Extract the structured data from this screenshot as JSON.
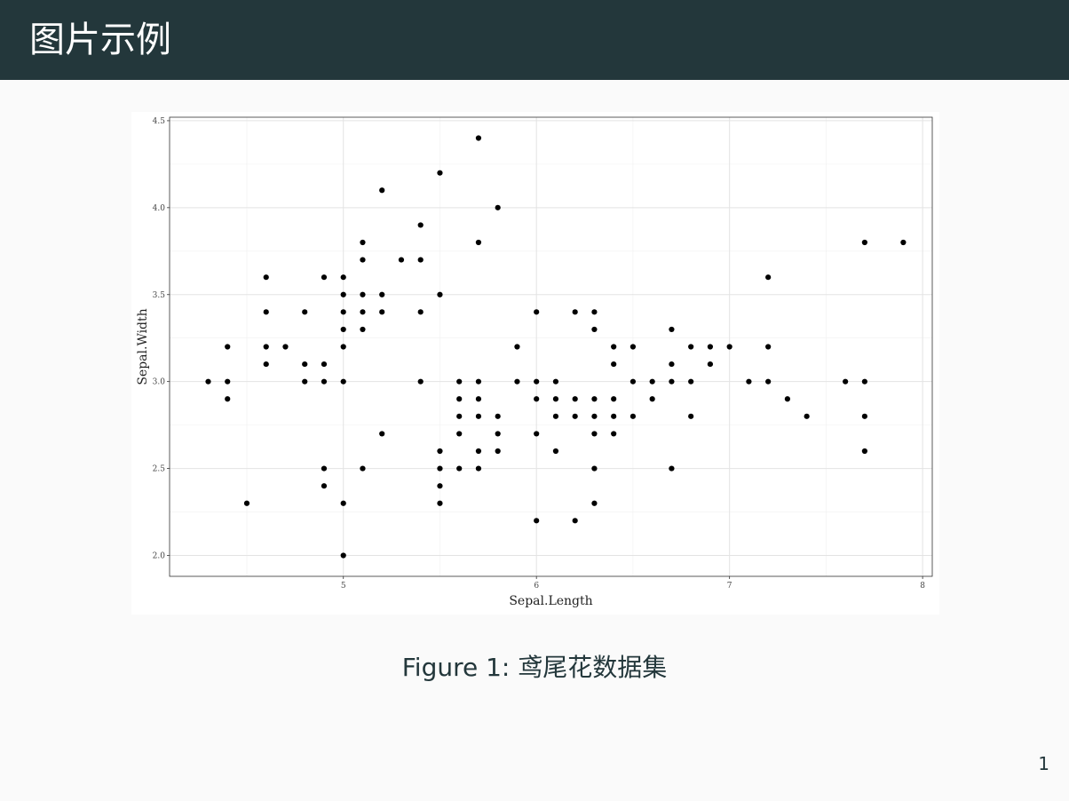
{
  "header": {
    "title": "图片示例"
  },
  "caption": {
    "label": "Figure 1:",
    "text": "鸢尾花数据集"
  },
  "page_number": "1",
  "chart_data": {
    "type": "scatter",
    "xlabel": "Sepal.Length",
    "ylabel": "Sepal.Width",
    "xlim": [
      4.1,
      8.05
    ],
    "ylim": [
      1.88,
      4.52
    ],
    "x_ticks": [
      5,
      6,
      7,
      8
    ],
    "x_tick_labels": [
      "5",
      "6",
      "7",
      "8"
    ],
    "y_ticks": [
      2.0,
      2.5,
      3.0,
      3.5,
      4.0,
      4.5
    ],
    "y_tick_labels": [
      "2.0",
      "2.5",
      "3.0",
      "3.5",
      "4.0",
      "4.5"
    ],
    "grid": true,
    "point_color": "#000000",
    "points": [
      [
        4.3,
        3.0
      ],
      [
        4.4,
        3.2
      ],
      [
        4.4,
        3.0
      ],
      [
        4.4,
        2.9
      ],
      [
        4.5,
        2.3
      ],
      [
        4.6,
        3.6
      ],
      [
        4.6,
        3.4
      ],
      [
        4.6,
        3.2
      ],
      [
        4.6,
        3.1
      ],
      [
        4.7,
        3.2
      ],
      [
        4.8,
        3.4
      ],
      [
        4.8,
        3.1
      ],
      [
        4.8,
        3.0
      ],
      [
        4.9,
        3.6
      ],
      [
        4.9,
        3.1
      ],
      [
        4.9,
        3.0
      ],
      [
        4.9,
        2.5
      ],
      [
        4.9,
        2.4
      ],
      [
        5.0,
        3.6
      ],
      [
        5.0,
        3.5
      ],
      [
        5.0,
        3.4
      ],
      [
        5.0,
        3.3
      ],
      [
        5.0,
        3.2
      ],
      [
        5.0,
        3.0
      ],
      [
        5.0,
        2.3
      ],
      [
        5.0,
        2.0
      ],
      [
        5.1,
        3.8
      ],
      [
        5.1,
        3.7
      ],
      [
        5.1,
        3.5
      ],
      [
        5.1,
        3.4
      ],
      [
        5.1,
        3.3
      ],
      [
        5.1,
        2.5
      ],
      [
        5.2,
        4.1
      ],
      [
        5.2,
        3.5
      ],
      [
        5.2,
        3.4
      ],
      [
        5.2,
        2.7
      ],
      [
        5.3,
        3.7
      ],
      [
        5.4,
        3.9
      ],
      [
        5.4,
        3.7
      ],
      [
        5.4,
        3.4
      ],
      [
        5.4,
        3.0
      ],
      [
        5.5,
        4.2
      ],
      [
        5.5,
        3.5
      ],
      [
        5.5,
        2.6
      ],
      [
        5.5,
        2.5
      ],
      [
        5.5,
        2.4
      ],
      [
        5.5,
        2.3
      ],
      [
        5.6,
        3.0
      ],
      [
        5.6,
        2.9
      ],
      [
        5.6,
        2.8
      ],
      [
        5.6,
        2.7
      ],
      [
        5.6,
        2.5
      ],
      [
        5.7,
        4.4
      ],
      [
        5.7,
        3.8
      ],
      [
        5.7,
        3.0
      ],
      [
        5.7,
        2.9
      ],
      [
        5.7,
        2.8
      ],
      [
        5.7,
        2.6
      ],
      [
        5.7,
        2.5
      ],
      [
        5.8,
        4.0
      ],
      [
        5.8,
        2.8
      ],
      [
        5.8,
        2.7
      ],
      [
        5.8,
        2.6
      ],
      [
        5.9,
        3.2
      ],
      [
        5.9,
        3.0
      ],
      [
        6.0,
        3.4
      ],
      [
        6.0,
        3.0
      ],
      [
        6.0,
        2.9
      ],
      [
        6.0,
        2.7
      ],
      [
        6.0,
        2.2
      ],
      [
        6.1,
        3.0
      ],
      [
        6.1,
        2.9
      ],
      [
        6.1,
        2.8
      ],
      [
        6.1,
        2.6
      ],
      [
        6.2,
        3.4
      ],
      [
        6.2,
        2.9
      ],
      [
        6.2,
        2.8
      ],
      [
        6.2,
        2.2
      ],
      [
        6.3,
        3.4
      ],
      [
        6.3,
        3.3
      ],
      [
        6.3,
        2.9
      ],
      [
        6.3,
        2.8
      ],
      [
        6.3,
        2.7
      ],
      [
        6.3,
        2.5
      ],
      [
        6.3,
        2.3
      ],
      [
        6.4,
        3.2
      ],
      [
        6.4,
        3.1
      ],
      [
        6.4,
        2.9
      ],
      [
        6.4,
        2.8
      ],
      [
        6.4,
        2.7
      ],
      [
        6.5,
        3.2
      ],
      [
        6.5,
        3.0
      ],
      [
        6.5,
        2.8
      ],
      [
        6.6,
        3.0
      ],
      [
        6.6,
        2.9
      ],
      [
        6.7,
        3.3
      ],
      [
        6.7,
        3.1
      ],
      [
        6.7,
        3.0
      ],
      [
        6.7,
        2.5
      ],
      [
        6.8,
        3.2
      ],
      [
        6.8,
        3.0
      ],
      [
        6.8,
        2.8
      ],
      [
        6.9,
        3.2
      ],
      [
        6.9,
        3.1
      ],
      [
        7.0,
        3.2
      ],
      [
        7.1,
        3.0
      ],
      [
        7.2,
        3.6
      ],
      [
        7.2,
        3.2
      ],
      [
        7.2,
        3.0
      ],
      [
        7.3,
        2.9
      ],
      [
        7.4,
        2.8
      ],
      [
        7.6,
        3.0
      ],
      [
        7.7,
        3.8
      ],
      [
        7.7,
        3.0
      ],
      [
        7.7,
        2.8
      ],
      [
        7.7,
        2.6
      ],
      [
        7.9,
        3.8
      ]
    ]
  }
}
